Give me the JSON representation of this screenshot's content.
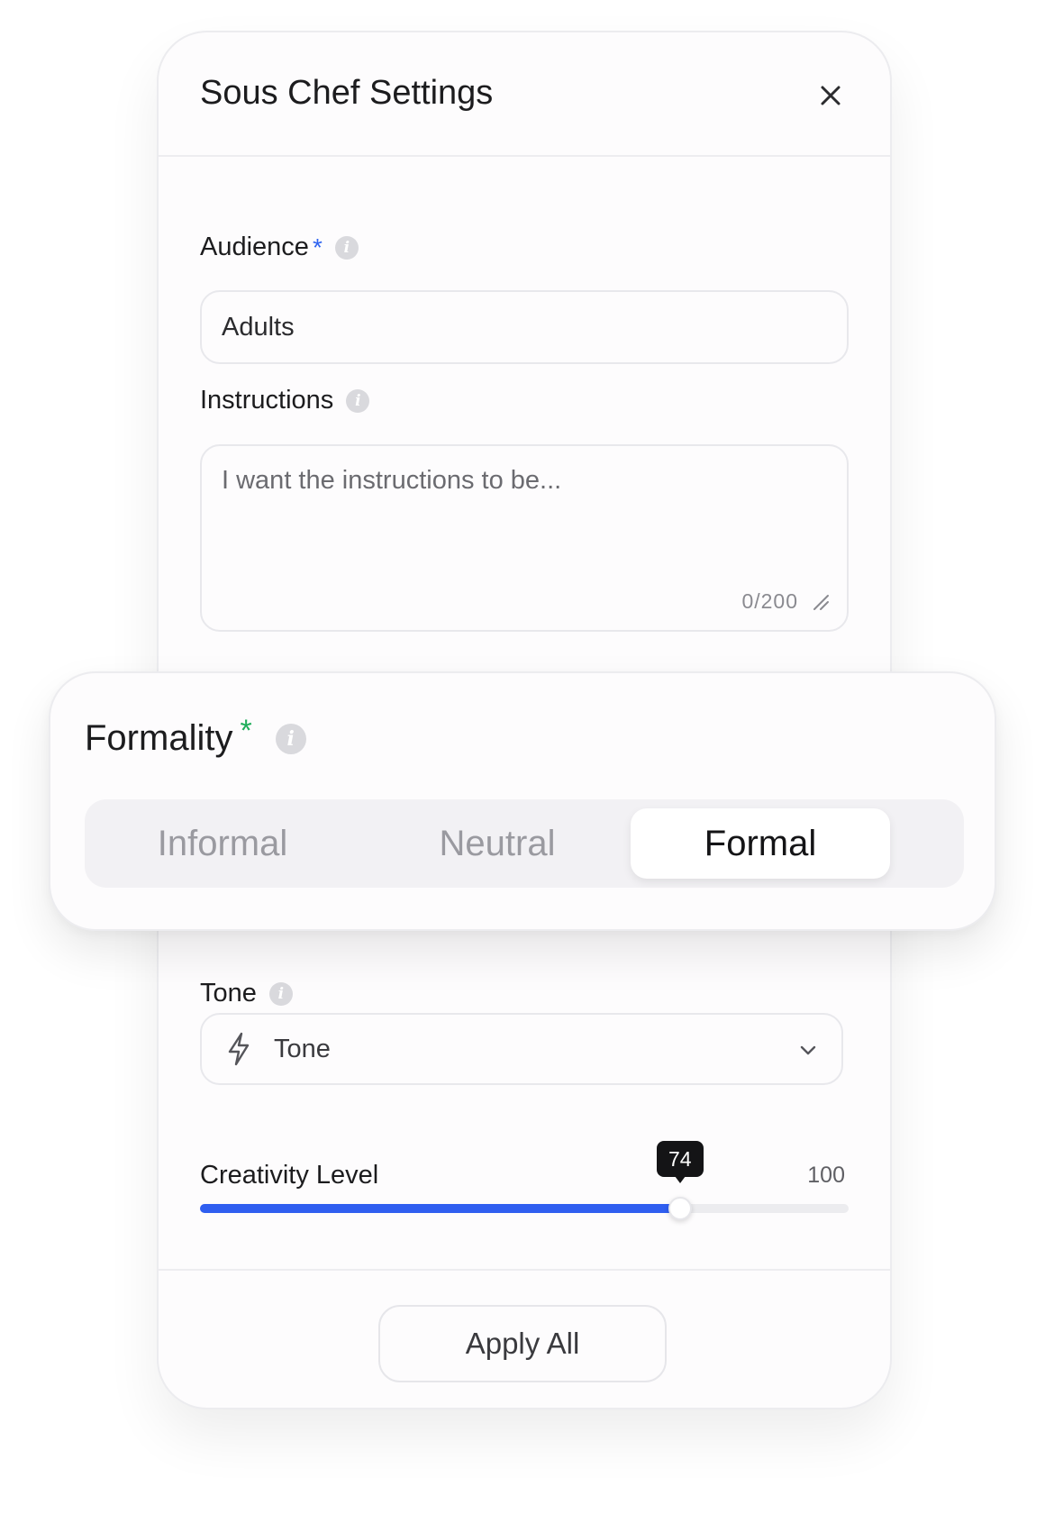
{
  "dialog": {
    "title": "Sous Chef Settings",
    "close_icon": "close-icon"
  },
  "audience": {
    "label": "Audience",
    "required_mark": "*",
    "value": "Adults"
  },
  "instructions": {
    "label": "Instructions",
    "placeholder": "I want the instructions to be...",
    "counter": "0/200"
  },
  "formality": {
    "label": "Formality",
    "required_mark": "*",
    "options": [
      "Informal",
      "Neutral",
      "Formal"
    ],
    "selected": "Formal"
  },
  "tone": {
    "label": "Tone",
    "icon": "bolt-icon",
    "value": "Tone"
  },
  "creativity": {
    "label": "Creativity Level",
    "value": 74,
    "value_label": "74",
    "max_label": "100",
    "fill_color": "#2f5ef0"
  },
  "footer": {
    "apply_label": "Apply All"
  },
  "colors": {
    "accent": "#2f64f0",
    "required_green": "#1fae5b"
  }
}
